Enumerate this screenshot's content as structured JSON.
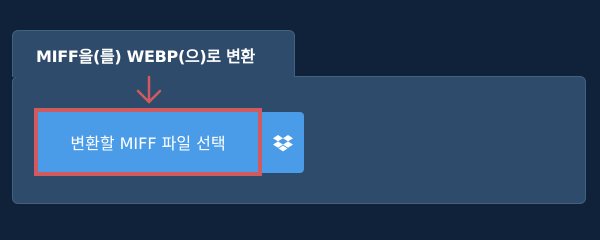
{
  "converter": {
    "title": "MIFF을(를) WEBP(으)로 변환",
    "upload_button_label": "변환할 MIFF 파일 선택",
    "dropbox_icon": "dropbox-icon"
  },
  "colors": {
    "page_bg": "#10223a",
    "panel_bg": "#2e4b6c",
    "button_bg": "#4a9ce8",
    "highlight": "#d05a5e"
  }
}
